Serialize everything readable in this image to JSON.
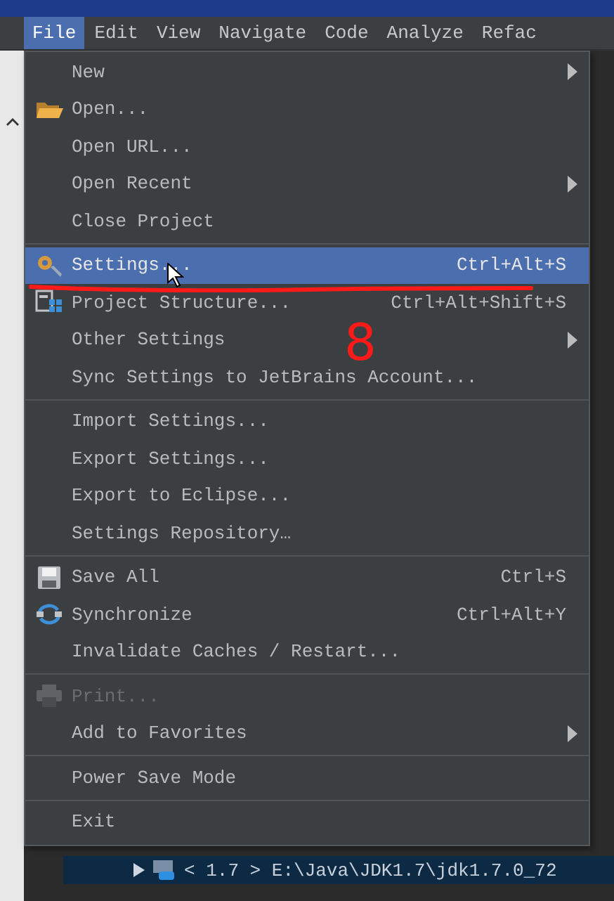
{
  "menu_bar": [
    {
      "label": "File",
      "selected": true
    },
    {
      "label": "Edit",
      "selected": false
    },
    {
      "label": "View",
      "selected": false
    },
    {
      "label": "Navigate",
      "selected": false
    },
    {
      "label": "Code",
      "selected": false
    },
    {
      "label": "Analyze",
      "selected": false
    },
    {
      "label": "Refac",
      "selected": false
    }
  ],
  "file_menu": [
    {
      "kind": "plain",
      "label": "New",
      "submenu": true,
      "selected": false,
      "disabled": false
    },
    {
      "kind": "folder",
      "label": "Open...",
      "selected": false,
      "disabled": false
    },
    {
      "kind": "plain",
      "label": "Open URL...",
      "selected": false,
      "disabled": false
    },
    {
      "kind": "plain",
      "label": "Open Recent",
      "submenu": true,
      "selected": false,
      "disabled": false
    },
    {
      "kind": "plain",
      "label": "Close Project",
      "selected": false,
      "disabled": false
    },
    {
      "kind": "separator"
    },
    {
      "kind": "gear",
      "label": "Settings...",
      "shortcut": "Ctrl+Alt+S",
      "selected": true,
      "disabled": false
    },
    {
      "kind": "structure",
      "label": "Project Structure...",
      "shortcut": "Ctrl+Alt+Shift+S",
      "selected": false,
      "disabled": false
    },
    {
      "kind": "plain",
      "label": "Other Settings",
      "submenu": true,
      "selected": false,
      "disabled": false
    },
    {
      "kind": "plain",
      "label": "Sync Settings to JetBrains Account...",
      "selected": false,
      "disabled": false
    },
    {
      "kind": "separator"
    },
    {
      "kind": "plain",
      "label": "Import Settings...",
      "selected": false,
      "disabled": false
    },
    {
      "kind": "plain",
      "label": "Export Settings...",
      "selected": false,
      "disabled": false
    },
    {
      "kind": "plain",
      "label": "Export to Eclipse...",
      "selected": false,
      "disabled": false
    },
    {
      "kind": "plain",
      "label": "Settings Repository…",
      "selected": false,
      "disabled": false
    },
    {
      "kind": "separator"
    },
    {
      "kind": "floppy",
      "label": "Save All",
      "shortcut": "Ctrl+S",
      "selected": false,
      "disabled": false
    },
    {
      "kind": "sync",
      "label": "Synchronize",
      "shortcut": "Ctrl+Alt+Y",
      "selected": false,
      "disabled": false
    },
    {
      "kind": "plain",
      "label": "Invalidate Caches / Restart...",
      "selected": false,
      "disabled": false
    },
    {
      "kind": "separator"
    },
    {
      "kind": "printer",
      "label": "Print...",
      "selected": false,
      "disabled": true
    },
    {
      "kind": "plain",
      "label": "Add to Favorites",
      "submenu": true,
      "selected": false,
      "disabled": false
    },
    {
      "kind": "separator"
    },
    {
      "kind": "plain",
      "label": "Power Save Mode",
      "selected": false,
      "disabled": false
    },
    {
      "kind": "separator"
    },
    {
      "kind": "plain",
      "label": "Exit",
      "selected": false,
      "disabled": false
    }
  ],
  "tree_row": {
    "label": "< 1.7 > E:\\Java\\JDK1.7\\jdk1.7.0_72",
    "selected": true
  },
  "annotation": {
    "mark": "8"
  }
}
